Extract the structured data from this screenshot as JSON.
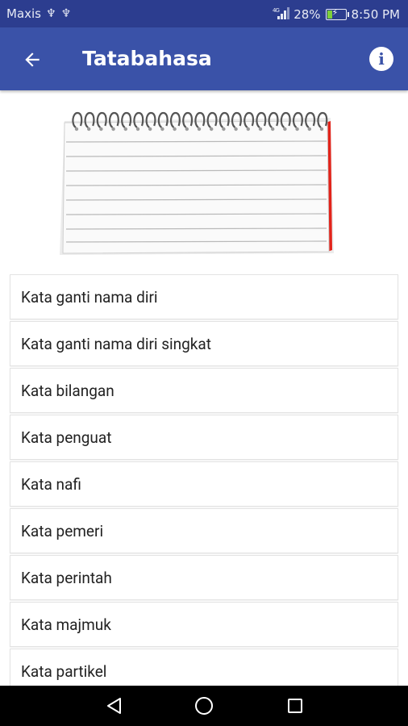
{
  "status_bar": {
    "carrier": "Maxis",
    "usb_icons": [
      "usb-icon",
      "usb-icon"
    ],
    "network_type": "4G",
    "battery_percent": "28%",
    "battery_level": 0.28,
    "time": "8:50 PM"
  },
  "app_bar": {
    "title": "Tatabahasa",
    "back_icon": "arrow-left-icon",
    "info_icon": "info-icon",
    "color": "#3a52a8"
  },
  "header_image": {
    "icon": "spiral-notebook-illustration"
  },
  "items": [
    "Kata ganti nama diri",
    "Kata ganti nama diri singkat",
    "Kata bilangan",
    "Kata penguat",
    "Kata nafi",
    "Kata pemeri",
    "Kata perintah",
    "Kata majmuk",
    "Kata partikel"
  ],
  "nav_bar": {
    "back_icon": "nav-back-triangle-icon",
    "home_icon": "nav-home-circle-icon",
    "recents_icon": "nav-recents-square-icon"
  }
}
